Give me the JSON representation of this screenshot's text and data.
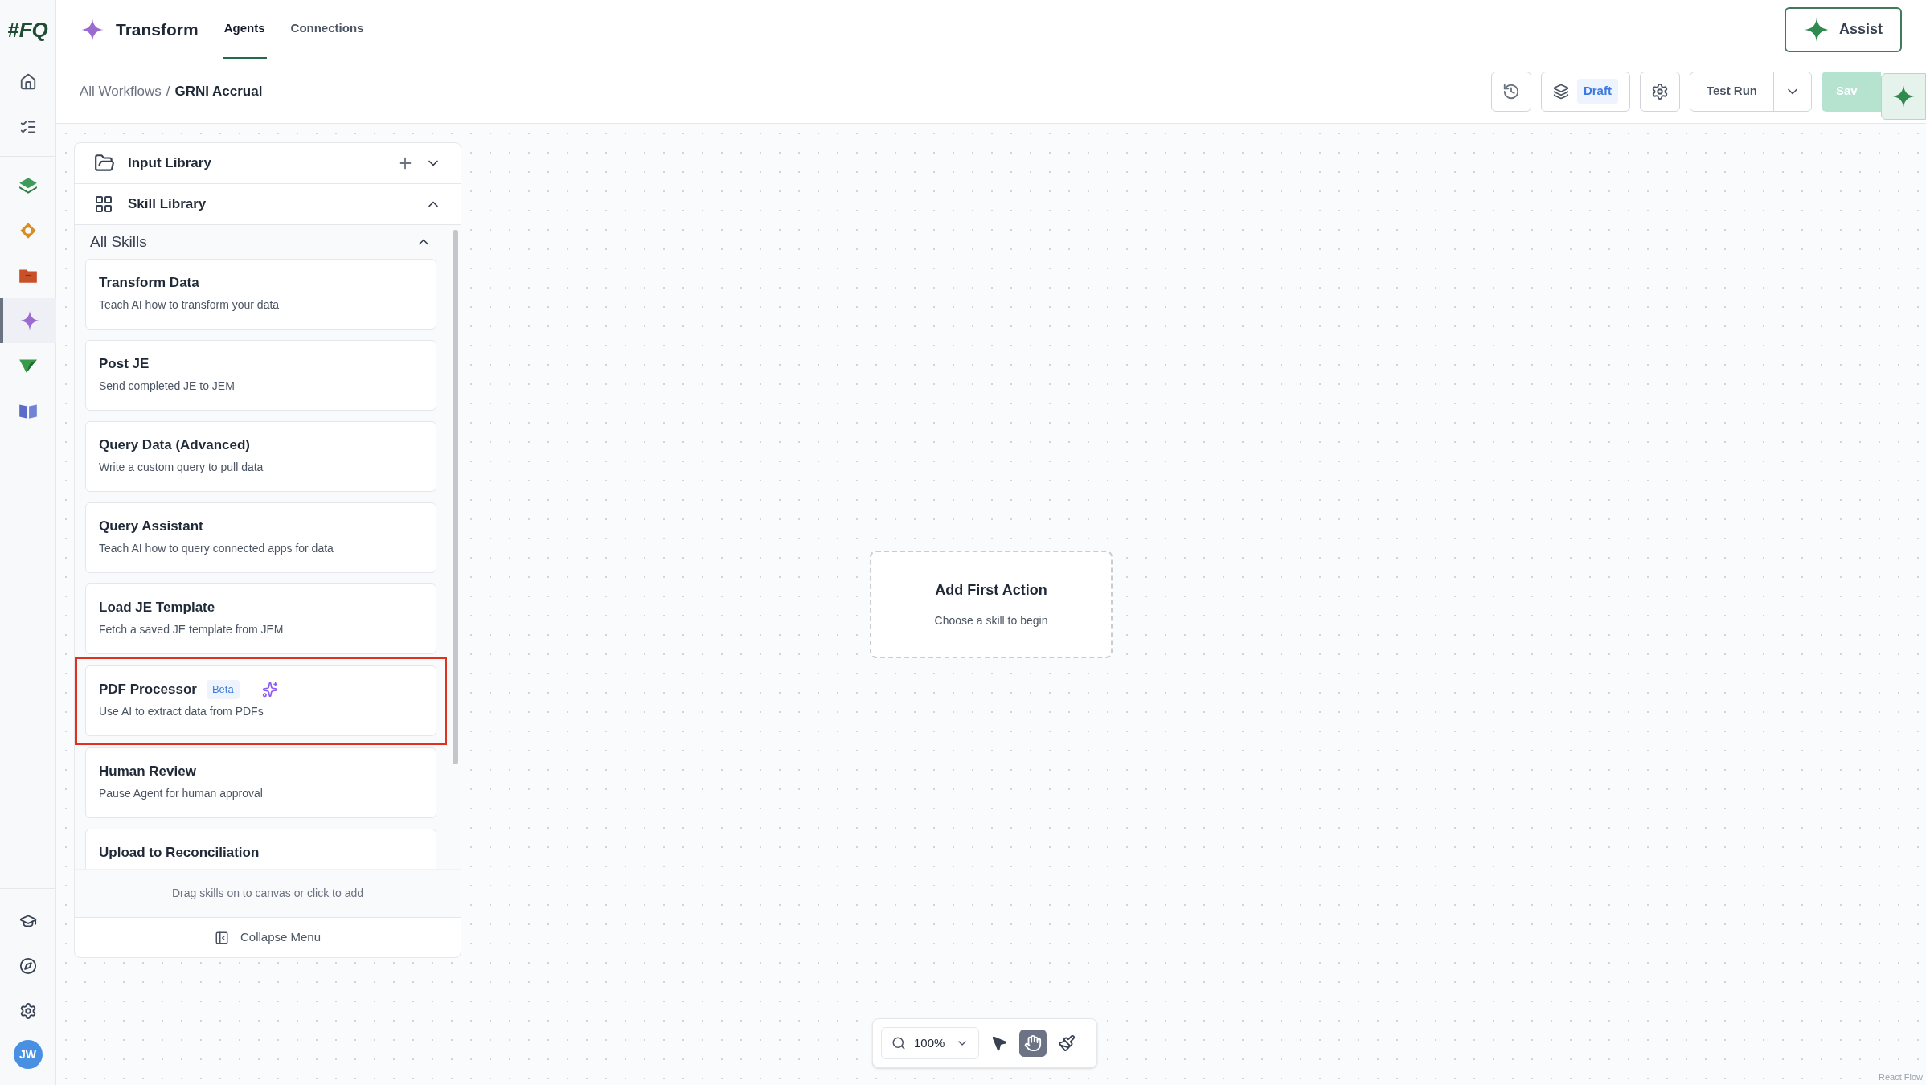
{
  "rail": {
    "logo": "#FQ",
    "items": [
      {
        "kind": "home",
        "selected": false
      },
      {
        "kind": "tasks",
        "selected": false
      },
      {
        "kind": "layers",
        "selected": false
      },
      {
        "kind": "ring",
        "selected": false
      },
      {
        "kind": "folder",
        "selected": false
      },
      {
        "kind": "sparkle",
        "selected": true
      },
      {
        "kind": "plane",
        "selected": false
      },
      {
        "kind": "book",
        "selected": false
      }
    ],
    "bottom": [
      {
        "kind": "cap"
      },
      {
        "kind": "compass"
      },
      {
        "kind": "gear"
      }
    ],
    "avatar": "JW"
  },
  "header": {
    "title": "Transform",
    "tabs": [
      {
        "label": "Agents",
        "selected": true
      },
      {
        "label": "Connections",
        "selected": false
      }
    ],
    "assist": "Assist"
  },
  "breadcrumb": {
    "parent": "All Workflows",
    "separator": "/",
    "current": "GRNI Accrual"
  },
  "toolbar": {
    "status": "Draft",
    "test_run": "Test Run",
    "save": "Sav"
  },
  "panel": {
    "input_library": "Input Library",
    "skill_library": "Skill Library",
    "section": "All Skills",
    "skills": [
      {
        "title": "Transform Data",
        "desc": "Teach AI how to transform your data",
        "highlighted": false
      },
      {
        "title": "Post JE",
        "desc": "Send completed JE to JEM",
        "highlighted": false
      },
      {
        "title": "Query Data (Advanced)",
        "desc": "Write a custom query to pull data",
        "highlighted": false
      },
      {
        "title": "Query Assistant",
        "desc": "Teach AI how to query connected apps for data",
        "highlighted": false
      },
      {
        "title": "Load JE Template",
        "desc": "Fetch a saved JE template from JEM",
        "highlighted": false
      },
      {
        "title": "PDF Processor",
        "badge": "Beta",
        "ai": true,
        "desc": "Use AI to extract data from PDFs",
        "highlighted": true
      },
      {
        "title": "Human Review",
        "desc": "Pause Agent for human approval",
        "highlighted": false
      },
      {
        "title": "Upload to Reconciliation",
        "highlighted": false
      }
    ],
    "hint": "Drag skills on to canvas or click to add",
    "collapse": "Collapse Menu"
  },
  "canvas": {
    "card_title": "Add First Action",
    "card_subtitle": "Choose a skill to begin",
    "zoom": "100%",
    "tools": [
      {
        "kind": "pointer",
        "selected": false
      },
      {
        "kind": "hand",
        "selected": true
      },
      {
        "kind": "broom",
        "selected": false
      }
    ],
    "attribution": "React Flow"
  }
}
